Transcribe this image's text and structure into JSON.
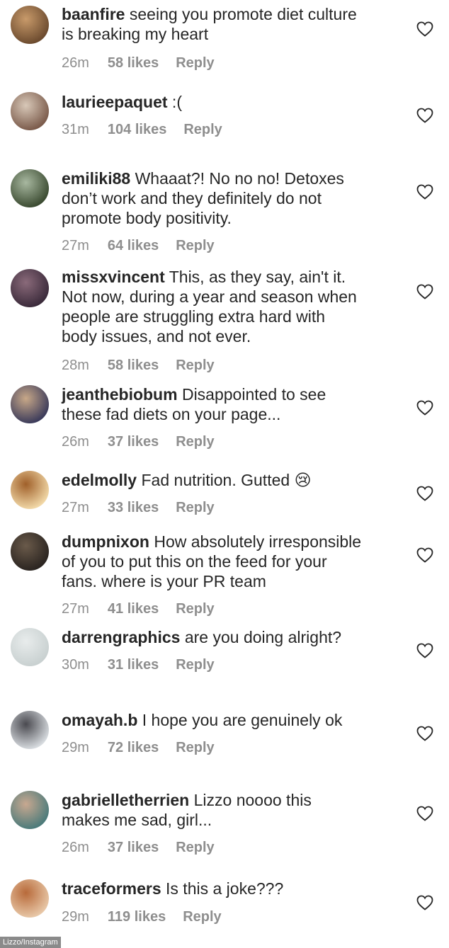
{
  "comments": [
    {
      "user": "baanfire",
      "text": " seeing you promote diet culture\nis breaking my heart",
      "time": "26m",
      "likes": "58 likes",
      "reply": "Reply",
      "colors": [
        "#6b4a2e",
        "#c89a6a"
      ]
    },
    {
      "user": "laurieepaquet",
      "text": " :(",
      "time": "31m",
      "likes": "104 likes",
      "reply": "Reply",
      "colors": [
        "#7a5a4a",
        "#d8c8b8"
      ]
    },
    {
      "user": "emiliki88",
      "text": " Whaaat?! No no no! Detoxes\ndon’t work and they definitely do not\npromote body positivity.",
      "time": "27m",
      "likes": "64 likes",
      "reply": "Reply",
      "colors": [
        "#3a4a30",
        "#a8b8a0"
      ]
    },
    {
      "user": "missxvincent",
      "text": " This, as they say, ain't it.\nNot now, during a year and season when\npeople are struggling extra hard with\nbody issues, and not ever.",
      "time": "28m",
      "likes": "58 likes",
      "reply": "Reply",
      "colors": [
        "#3a2a3a",
        "#8a6a7a"
      ]
    },
    {
      "user": "jeanthebiobum",
      "text": " Disappointed to see\nthese fad diets on your page...",
      "time": "26m",
      "likes": "37 likes",
      "reply": "Reply",
      "colors": [
        "#3a3a5a",
        "#c8a888"
      ]
    },
    {
      "user": "edelmolly",
      "text": " Fad nutrition. Gutted 😢",
      "time": "27m",
      "likes": "33 likes",
      "reply": "Reply",
      "colors": [
        "#f2d9a8",
        "#a0602a"
      ]
    },
    {
      "user": "dumpnixon",
      "text": " How absolutely irresponsible\nof you to put this on the feed for your\nfans. where is your PR team",
      "time": "27m",
      "likes": "41 likes",
      "reply": "Reply",
      "colors": [
        "#2a2420",
        "#6a5a4a"
      ]
    },
    {
      "user": "darrengraphics",
      "text": " are you doing alright?",
      "time": "30m",
      "likes": "31 likes",
      "reply": "Reply",
      "colors": [
        "#c8d0d0",
        "#e8ecec"
      ]
    },
    {
      "user": "omayah.b",
      "text": " I hope you are genuinely ok",
      "time": "29m",
      "likes": "72 likes",
      "reply": "Reply",
      "colors": [
        "#d8dce0",
        "#4a4a50"
      ]
    },
    {
      "user": "gabrielletherrien",
      "text": " Lizzo noooo this\nmakes me sad, girl...",
      "time": "26m",
      "likes": "37 likes",
      "reply": "Reply",
      "colors": [
        "#4a7a7a",
        "#c8a890"
      ]
    },
    {
      "user": "traceformers",
      "text": " Is this a joke???",
      "time": "29m",
      "likes": "119 likes",
      "reply": "Reply",
      "colors": [
        "#e8c8a8",
        "#b86a3a"
      ]
    }
  ],
  "credit": "Lizzo/Instagram",
  "icons": {
    "like": "heart-outline-icon"
  }
}
